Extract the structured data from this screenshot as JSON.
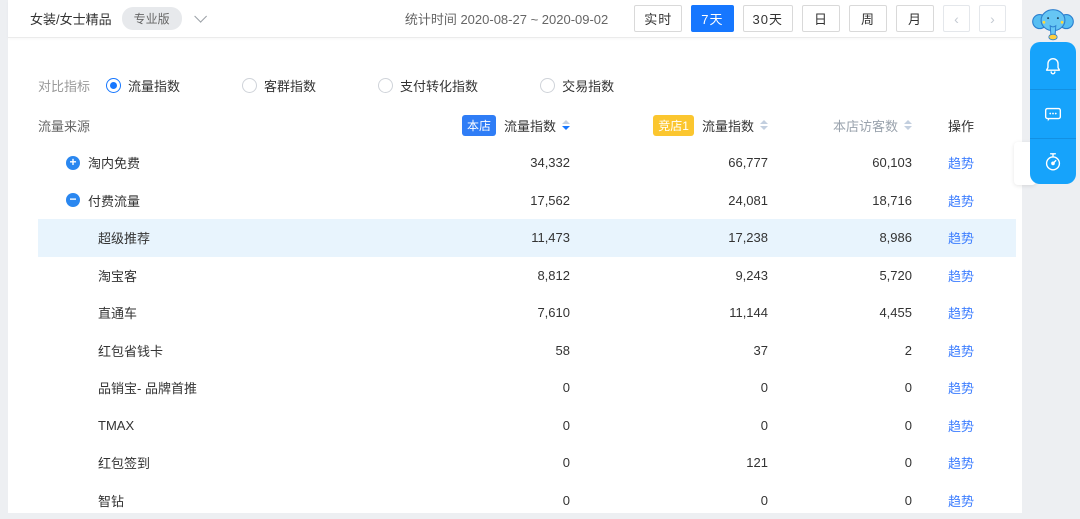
{
  "topbar": {
    "category": "女装/女士精品",
    "version_badge": "专业版",
    "stat_time": "统计时间 2020-08-27 ~ 2020-09-02",
    "range_buttons": [
      "实时",
      "7天",
      "30天",
      "日",
      "周",
      "月"
    ],
    "active_range": "7天",
    "pager_prev": "‹",
    "pager_next": "›"
  },
  "metrics": {
    "label": "对比指标",
    "options": [
      "流量指数",
      "客群指数",
      "支付转化指数",
      "交易指数"
    ],
    "selected": "流量指数"
  },
  "table": {
    "source_header": "流量来源",
    "own_badge": "本店",
    "own_metric_header": "流量指数",
    "competitor_badge": "竞店1",
    "competitor_metric_header": "流量指数",
    "visitors_header": "本店访客数",
    "action_header": "操作",
    "trend_label": "趋势",
    "sort_state": "own-descending",
    "rows": [
      {
        "name": "淘内免费",
        "level": "parent",
        "expand": "plus",
        "own": "34,332",
        "comp": "66,777",
        "visitors": "60,103"
      },
      {
        "name": "付费流量",
        "level": "parent",
        "expand": "minus",
        "own": "17,562",
        "comp": "24,081",
        "visitors": "18,716"
      },
      {
        "name": "超级推荐",
        "level": "child",
        "highlight": true,
        "own": "11,473",
        "comp": "17,238",
        "visitors": "8,986"
      },
      {
        "name": "淘宝客",
        "level": "child",
        "own": "8,812",
        "comp": "9,243",
        "visitors": "5,720"
      },
      {
        "name": "直通车",
        "level": "child",
        "own": "7,610",
        "comp": "11,144",
        "visitors": "4,455"
      },
      {
        "name": "红包省钱卡",
        "level": "child",
        "own": "58",
        "comp": "37",
        "visitors": "2"
      },
      {
        "name": "品销宝- 品牌首推",
        "level": "child",
        "own": "0",
        "comp": "0",
        "visitors": "0"
      },
      {
        "name": "TMAX",
        "level": "child",
        "own": "0",
        "comp": "0",
        "visitors": "0"
      },
      {
        "name": "红包签到",
        "level": "child",
        "own": "0",
        "comp": "121",
        "visitors": "0"
      },
      {
        "name": "智钻",
        "level": "child",
        "own": "0",
        "comp": "0",
        "visitors": "0"
      }
    ]
  },
  "colors": {
    "accent_blue": "#1677ff",
    "own_badge_blue": "#2f7df6",
    "competitor_badge_yellow": "#fbc62f",
    "link_blue": "#3d7eff",
    "highlight_row": "#e8f4fd",
    "widget_blue": "#16a3fb"
  },
  "widget": {
    "icons": [
      "bell-icon",
      "message-icon",
      "timer-icon"
    ]
  }
}
